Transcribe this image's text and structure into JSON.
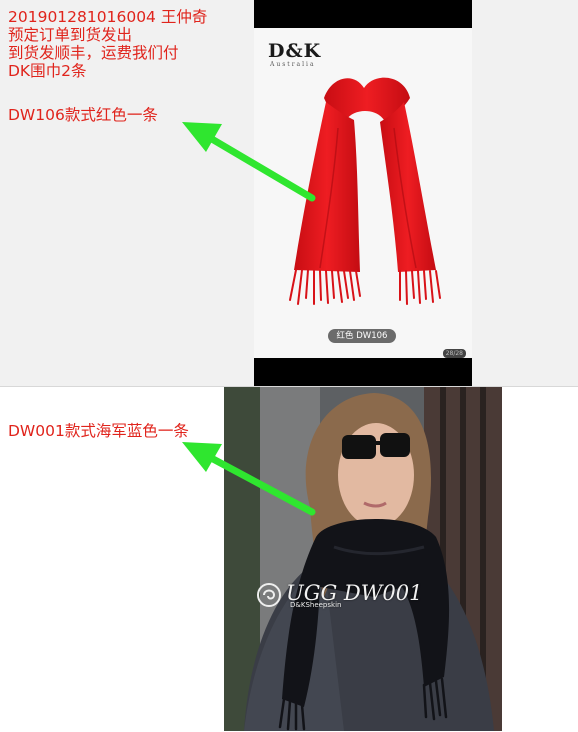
{
  "order": {
    "number_line": "201901281016004    王仲奇",
    "line2": "预定订单到货发出",
    "line3": "到货发顺丰，运费我们付",
    "line4": "DK围巾2条"
  },
  "items": [
    {
      "note": "DW106款式红色一条"
    },
    {
      "note": "DW001款式海军蓝色一条"
    }
  ],
  "photo1": {
    "brand": "D&K",
    "brand_sub": "Australia",
    "color_tag": "红色 DW106",
    "counter": "28/28"
  },
  "photo2": {
    "watermark": "UGG DW001",
    "watermark_sub": "D&KSheepskin"
  },
  "colors": {
    "note_red": "#e0241c",
    "arrow_green": "#2fe62f",
    "scarf_red": "#e8141a",
    "scarf_navy": "#0f1015"
  }
}
